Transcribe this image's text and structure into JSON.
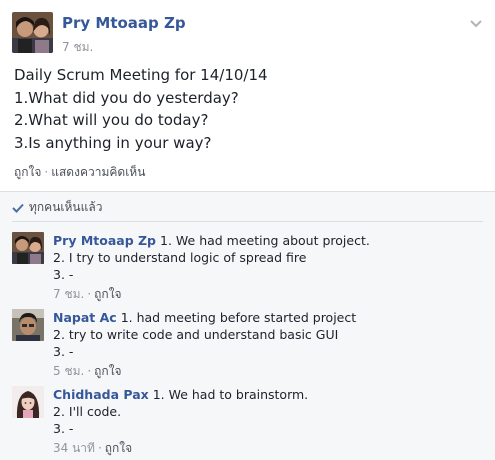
{
  "post": {
    "author": "Pry Mtoaap Zp",
    "time": "7 ชม.",
    "lines": [
      "Daily Scrum Meeting for 14/10/14",
      "1.What did you do yesterday?",
      "2.What will you do today?",
      "3.Is anything in your way?"
    ],
    "like_label": "ถูกใจ",
    "comment_label": "แสดงความคิดเห็น"
  },
  "seen": {
    "label": "ทุกคนเห็นแล้ว"
  },
  "comments": [
    {
      "author": "Pry Mtoaap Zp",
      "first_line": "1. We had meeting about project.",
      "line2": "2. I try to understand logic of spread fire",
      "line3": "3. -",
      "time": "7 ชม.",
      "like_label": "ถูกใจ"
    },
    {
      "author": "Napat Ac",
      "first_line": "1. had meeting before started project",
      "line2": "2. try to write code and understand basic GUI",
      "line3": "3. -",
      "time": "5 ชม.",
      "like_label": "ถูกใจ"
    },
    {
      "author": "Chidhada Pax",
      "first_line": "1. We had to brainstorm.",
      "line2": "2. I'll code.",
      "line3": "3. -",
      "time": "34 นาที",
      "like_label": "ถูกใจ"
    }
  ],
  "icons": {
    "chevron": "chevron-down-icon",
    "check": "checkmark-icon"
  },
  "colors": {
    "name_link": "#365899",
    "meta_text": "#90949c",
    "comment_bg": "#f6f7f9",
    "post_bg": "#ffffff"
  }
}
